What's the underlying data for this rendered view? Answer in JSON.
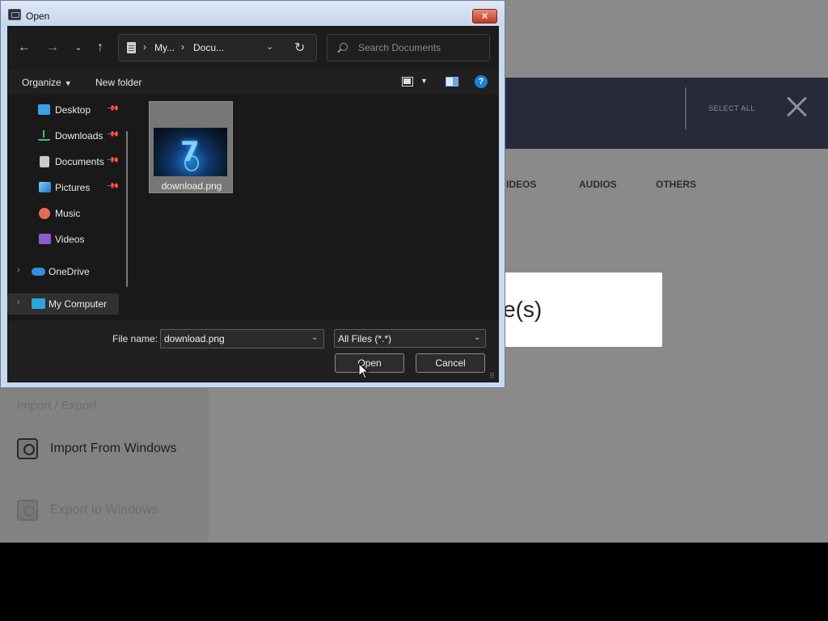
{
  "background_app": {
    "select_all_label": "SELECT ALL",
    "tabs": [
      "IDEOS",
      "AUDIOS",
      "OTHERS"
    ],
    "card_text": "e(s)",
    "section_title": "Import / Export",
    "import_label": "Import From Windows",
    "export_label": "Export to Windows"
  },
  "dialog": {
    "title": "Open",
    "close_glyph": "✕",
    "nav": {
      "back_glyph": "←",
      "forward_glyph": "→",
      "recent_glyph": "⌄",
      "up_glyph": "↑"
    },
    "address": {
      "crumbs": [
        "My...",
        "Docu..."
      ],
      "separator": "›",
      "dropdown_glyph": "⌄",
      "refresh_glyph": "↻"
    },
    "search": {
      "placeholder": "Search Documents",
      "value": ""
    },
    "commands": {
      "organize_label": "Organize",
      "organize_caret": "▼",
      "new_folder_label": "New folder",
      "view_caret": "▼",
      "help_glyph": "?"
    },
    "nav_pane": {
      "items": [
        {
          "label": "Desktop",
          "icon": "desktop-icon",
          "pinned": true
        },
        {
          "label": "Downloads",
          "icon": "download-icon",
          "pinned": true
        },
        {
          "label": "Documents",
          "icon": "document-icon",
          "pinned": true
        },
        {
          "label": "Pictures",
          "icon": "picture-icon",
          "pinned": true
        },
        {
          "label": "Music",
          "icon": "music-icon",
          "pinned": false
        },
        {
          "label": "Videos",
          "icon": "video-icon",
          "pinned": false
        },
        {
          "label": "OneDrive",
          "icon": "cloud-icon",
          "pinned": false
        },
        {
          "label": "My Computer",
          "icon": "computer-icon",
          "pinned": false
        }
      ],
      "pin_glyph": "📌",
      "chevron_glyph": "›"
    },
    "files": [
      {
        "name": "download.png",
        "thumbnail_text": "7",
        "selected": true
      }
    ],
    "file_name_label": "File name:",
    "file_name_value": "download.png",
    "file_type_value": "All Files (*.*)",
    "dropdown_glyph": "⌄",
    "open_label": "Open",
    "cancel_label": "Cancel",
    "grip_glyph": "⠿"
  },
  "colors": {
    "dialog_frame": "#c9d9ef",
    "dialog_bg": "#191919",
    "topbar": "#262a3a",
    "app_bg": "#8a8a8a",
    "accent_blue": "#1f7fd6"
  }
}
